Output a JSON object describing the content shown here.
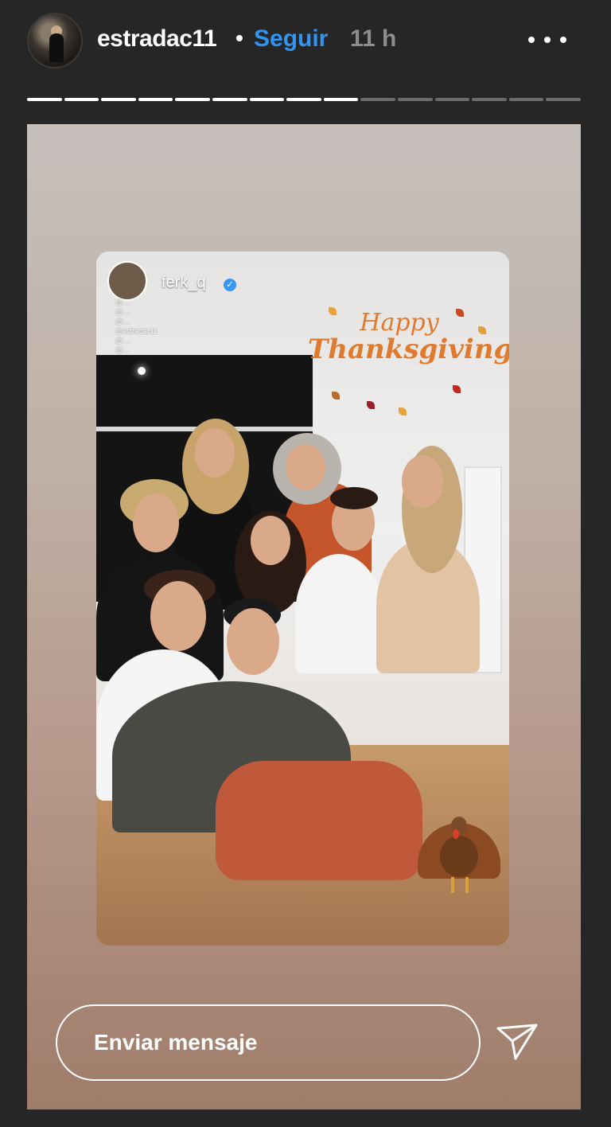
{
  "header": {
    "username": "estradac11",
    "separator": "•",
    "follow_label": "Seguir",
    "time_ago": "11 h"
  },
  "progress": {
    "segments_total": 15,
    "segments_done": 9
  },
  "story": {
    "shared_post": {
      "author": "ferk_q",
      "verified": true,
      "mentions": [
        "@…",
        "@…",
        "@…",
        "@estradac11",
        "@…",
        "@…"
      ],
      "sticker_text_line1": "Happy",
      "sticker_text_line2": "Thanksgiving"
    }
  },
  "footer": {
    "message_placeholder": "Enviar mensaje"
  },
  "colors": {
    "background": "#262626",
    "follow_blue": "#2f95f0",
    "thanksgiving_orange": "#e07a2e"
  },
  "icons": {
    "more": "more-horizontal-icon",
    "send": "paper-plane-icon",
    "verified": "verified-badge-icon"
  }
}
